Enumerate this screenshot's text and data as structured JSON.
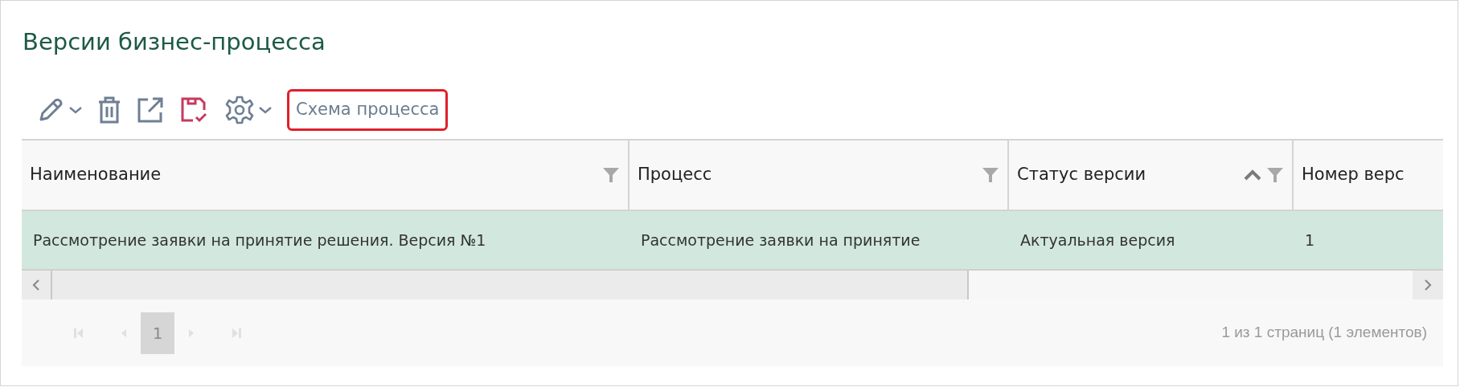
{
  "title": "Версии бизнес-процесса",
  "toolbar": [
    {
      "kind": "edit-menu"
    },
    {
      "kind": "delete"
    },
    {
      "kind": "open"
    },
    {
      "kind": "save"
    },
    {
      "kind": "settings-menu"
    },
    {
      "kind": "text",
      "label": "Схема процесса"
    }
  ],
  "table": {
    "columns": [
      {
        "label": "Наименование",
        "sorted": false,
        "filter": true
      },
      {
        "label": "Процесс",
        "sorted": false,
        "filter": true
      },
      {
        "label": "Статус версии",
        "sorted": true,
        "filter": true
      },
      {
        "label": "Номер верс",
        "sorted": false,
        "filter": false
      }
    ],
    "rows": [
      {
        "selected": true,
        "cells": [
          "Рассмотрение заявки на принятие решения. Версия №1",
          "Рассмотрение заявки на принятие",
          "Актуальная версия",
          "1"
        ]
      }
    ]
  },
  "pager": {
    "pages": [
      {
        "label": "1",
        "selected": true
      }
    ],
    "info": "1 из 1 страниц (1 элементов)"
  }
}
